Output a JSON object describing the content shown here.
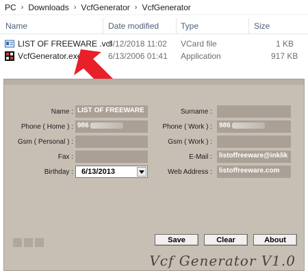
{
  "explorer": {
    "breadcrumb": [
      "PC",
      "Downloads",
      "VcfGenerator",
      "VcfGenerator"
    ],
    "columns": {
      "name": "Name",
      "date": "Date modified",
      "type": "Type",
      "size": "Size"
    },
    "files": [
      {
        "name": "LIST OF FREEWARE .vcf",
        "date": "6/12/2018 11:02",
        "type": "VCard file",
        "size": "1 KB",
        "icon": "vcard-file-icon"
      },
      {
        "name": "VcfGenerator.exe",
        "date": "6/13/2006 01:41",
        "type": "Application",
        "size": "917 KB",
        "icon": "application-icon"
      }
    ]
  },
  "annotation": {
    "color": "#e8202a",
    "icon": "red-arrow-icon"
  },
  "form": {
    "name_label": "Name :",
    "name_value": "LIST OF FREEWARE",
    "surname_label": "Surname :",
    "surname_value": "",
    "phone_home_label": "Phone ( Home ) :",
    "phone_home_value": "986",
    "phone_work_label": "Phone ( Work ) :",
    "phone_work_value": "986",
    "gsm_personal_label": "Gsm ( Personal ) :",
    "gsm_personal_value": "",
    "gsm_work_label": "Gsm ( Work ) :",
    "gsm_work_value": "",
    "fax_label": "Fax :",
    "fax_value": "",
    "email_label": "E-Mail :",
    "email_value": "listoffreeware@inklik",
    "birthday_label": "Birthday :",
    "birthday_value": "6/13/2013",
    "web_label": "Web Address :",
    "web_value": "listoffreeware.com"
  },
  "buttons": {
    "save": "Save",
    "clear": "Clear",
    "about": "About"
  },
  "brand": "Vcf Generator V1.0",
  "colors": {
    "window": "#c8bfb4",
    "field": "#aaa095"
  }
}
